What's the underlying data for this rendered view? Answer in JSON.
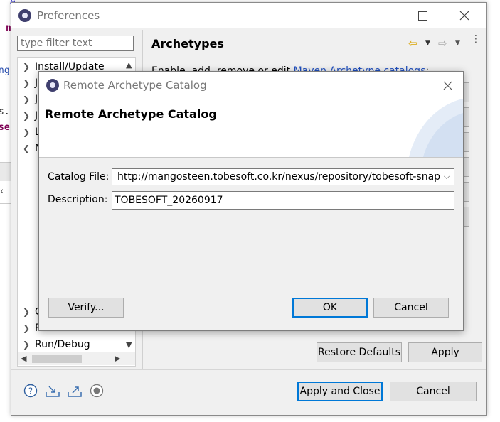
{
  "background": {
    "fragments": [
      "A",
      "n",
      "ng",
      "s.",
      "se"
    ]
  },
  "preferences": {
    "title": "Preferences",
    "filter_placeholder": "type filter text",
    "tree_items": [
      {
        "label": "Install/Update",
        "expanded": false
      },
      {
        "label": "J",
        "expanded": false
      },
      {
        "label": "J",
        "expanded": false
      },
      {
        "label": "J",
        "expanded": false
      },
      {
        "label": "L",
        "expanded": false
      },
      {
        "label": "M",
        "expanded": true
      },
      {
        "label": "C",
        "expanded": false
      },
      {
        "label": "P",
        "expanded": false
      },
      {
        "label": "Run/Debug",
        "expanded": false
      }
    ],
    "page_title": "Archetypes",
    "description_prefix": "Enable, add, remove or edit",
    "description_link": "Maven Archetype catalogs",
    "description_suffix": ":",
    "restore_defaults_label": "Restore Defaults",
    "apply_label": "Apply",
    "apply_and_close_label": "Apply and Close",
    "cancel_label": "Cancel"
  },
  "dialog": {
    "title": "Remote Archetype Catalog",
    "heading": "Remote Archetype Catalog",
    "catalog_file_label": "Catalog File:",
    "catalog_file_value": "http://mangosteen.tobesoft.co.kr/nexus/repository/tobesoft-snapshot",
    "description_label": "Description:",
    "description_value": "TOBESOFT_20260917",
    "verify_label": "Verify...",
    "ok_label": "OK",
    "cancel_label": "Cancel"
  },
  "colors": {
    "accent": "#0078d7",
    "link": "#1f4fbf",
    "dialog_bg": "#f0f0f0"
  }
}
